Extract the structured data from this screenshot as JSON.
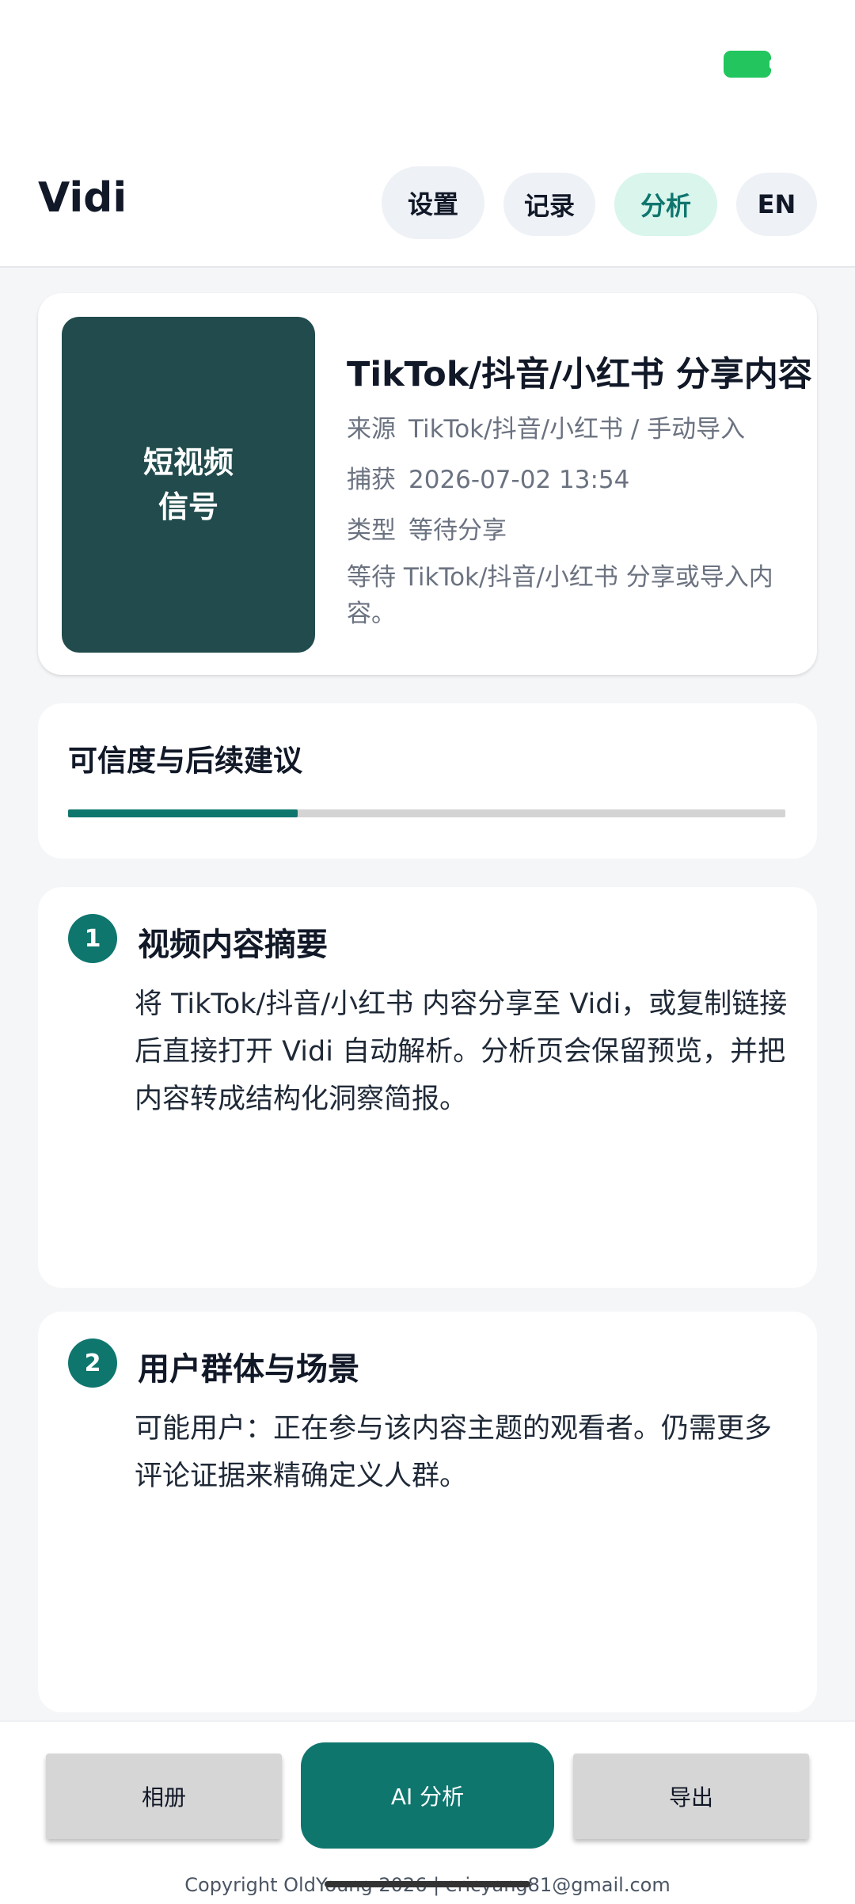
{
  "header": {
    "app_title": "Vidi",
    "nav": {
      "settings": "设置",
      "history": "记录",
      "analysis": "分析",
      "language": "EN"
    }
  },
  "info_card": {
    "thumbnail_line1": "短视频",
    "thumbnail_line2": "信号",
    "title": "TikTok/抖音/小红书 分享内容",
    "source_label": "来源",
    "source_value": "TikTok/抖音/小红书 / 手动导入",
    "captured_label": "捕获",
    "captured_value": "2026-07-02 13:54",
    "type_label": "类型",
    "type_value": "等待分享",
    "description": "等待 TikTok/抖音/小红书 分享或导入内容。"
  },
  "trust": {
    "title": "可信度与后续建议",
    "progress": 0.32
  },
  "sections": [
    {
      "number": "1",
      "title": "视频内容摘要",
      "body": "将 TikTok/抖音/小红书 内容分享至 Vidi，或复制链接后直接打开 Vidi 自动解析。分析页会保留预览，并把内容转成结构化洞察简报。"
    },
    {
      "number": "2",
      "title": "用户群体与场景",
      "body": "可能用户：正在参与该内容主题的观看者。仍需更多评论证据来精确定义人群。"
    }
  ],
  "bottom_bar": {
    "album": "相册",
    "ai_analysis": "AI 分析",
    "export": "导出",
    "copyright": "Copyright OldYoung 2026 | ericyang81@gmail.com"
  },
  "colors": {
    "accent": "#0f766e",
    "thumbnail_bg": "#214b4c",
    "battery": "#22c55e"
  }
}
